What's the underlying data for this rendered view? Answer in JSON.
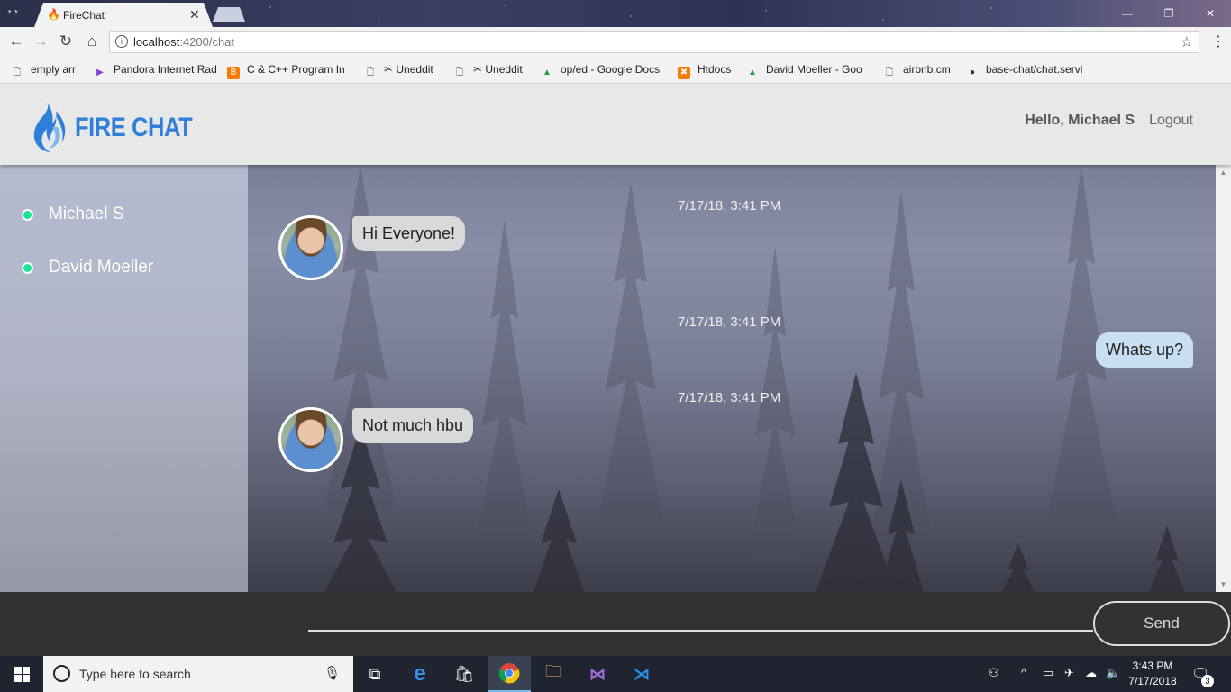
{
  "browser": {
    "tab_title": "FireChat",
    "url_host": "localhost",
    "url_path": ":4200/chat",
    "bookmarks": [
      {
        "label": "emply arr",
        "icon": "page-icon"
      },
      {
        "label": "Pandora Internet Rad",
        "icon": "pandora-icon"
      },
      {
        "label": "C & C++ Program In",
        "icon": "blogger-icon"
      },
      {
        "label": "Uneddit",
        "icon": "scissors-icon"
      },
      {
        "label": "Uneddit",
        "icon": "scissors-icon"
      },
      {
        "label": "op/ed - Google Docs",
        "icon": "drive-icon"
      },
      {
        "label": "Htdocs",
        "icon": "xampp-icon"
      },
      {
        "label": "David Moeller - Goo",
        "icon": "drive-icon"
      },
      {
        "label": "airbnb.cm",
        "icon": "page-icon"
      },
      {
        "label": "base-chat/chat.servi",
        "icon": "github-icon"
      }
    ]
  },
  "header": {
    "logo_text": "FIRE CHAT",
    "greeting": "Hello, Michael S",
    "logout_label": "Logout"
  },
  "sidebar": {
    "users": [
      {
        "name": "Michael S",
        "status": "online"
      },
      {
        "name": "David Moeller",
        "status": "online"
      }
    ],
    "online_color": "#19e694"
  },
  "messages": [
    {
      "timestamp": "7/17/18, 3:41 PM",
      "text": "Hi Everyone!",
      "direction": "incoming",
      "has_avatar": true
    },
    {
      "timestamp": "7/17/18, 3:41 PM",
      "text": "Whats up?",
      "direction": "outgoing",
      "has_avatar": false
    },
    {
      "timestamp": "7/17/18, 3:41 PM",
      "text": "Not much hbu",
      "direction": "incoming",
      "has_avatar": true
    }
  ],
  "composer": {
    "value": "",
    "send_label": "Send"
  },
  "taskbar": {
    "search_placeholder": "Type here to search",
    "time": "3:43 PM",
    "date": "7/17/2018",
    "notification_count": "3",
    "apps": [
      "task-view-icon",
      "edge-icon",
      "store-icon",
      "chrome-icon",
      "file-explorer-icon",
      "visual-studio-icon",
      "vscode-icon"
    ]
  },
  "colors": {
    "brand": "#2f7fd8",
    "header_bg": "#e8e8e8",
    "incoming_bubble": "#d9d9d9",
    "outgoing_bubble": "#c8def2",
    "input_bar": "#323232"
  }
}
